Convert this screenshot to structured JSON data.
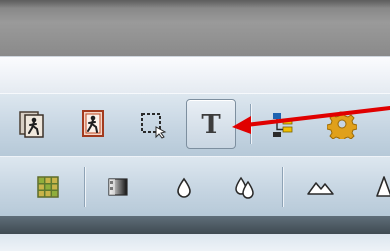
{
  "toolbar_row1": {
    "buttons": [
      {
        "id": "image-a",
        "icon": "image-frame-figure-icon"
      },
      {
        "id": "image-b",
        "icon": "image-frame-figure-red-icon"
      },
      {
        "id": "selection",
        "icon": "marquee-selection-icon"
      },
      {
        "id": "text",
        "icon": "text-tool-icon",
        "glyph": "T",
        "pressed": true
      },
      {
        "id": "flow",
        "icon": "flowchart-icon"
      },
      {
        "id": "settings",
        "icon": "gear-icon"
      }
    ]
  },
  "toolbar_row2": {
    "buttons": [
      {
        "id": "grid",
        "icon": "grid-icon"
      },
      {
        "id": "gradient",
        "icon": "gradient-fill-icon"
      },
      {
        "id": "drop",
        "icon": "water-drop-icon"
      },
      {
        "id": "drops",
        "icon": "double-drop-icon"
      },
      {
        "id": "mountain",
        "icon": "mountain-landscape-icon"
      },
      {
        "id": "cone",
        "icon": "cone-icon"
      }
    ]
  },
  "annotation": {
    "type": "arrow",
    "color": "#e00000"
  },
  "colors": {
    "toolbar": "#c6d5e2",
    "arrow": "#e00000"
  }
}
